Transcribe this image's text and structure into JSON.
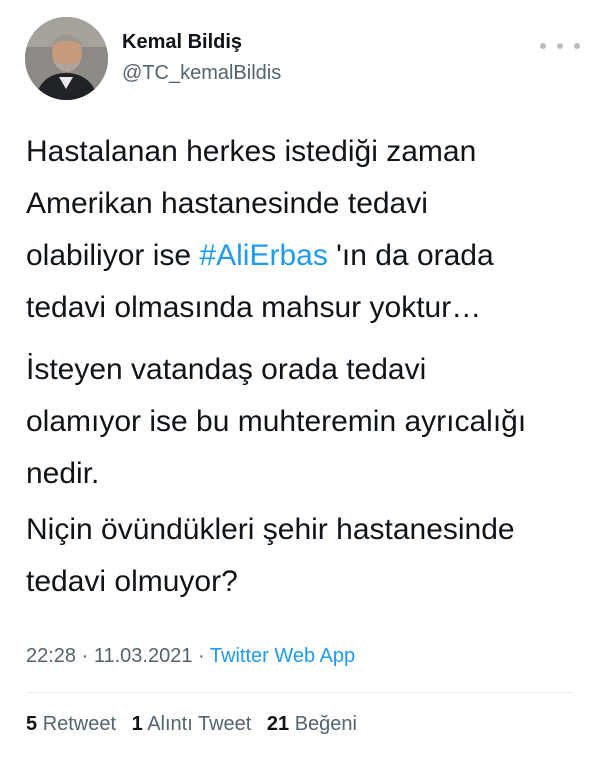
{
  "author": {
    "name": "Kemal Bildiş",
    "handle": "@TC_kemalBildis"
  },
  "tweet": {
    "p1": {
      "line1": "Hastalanan herkes istediği zaman",
      "line2": "Amerikan hastanesinde tedavi",
      "line3_before": "olabiliyor ise ",
      "hashtag": "#AliErbas",
      "line3_after": " 'ın da orada",
      "line4": "tedavi olmasında mahsur yoktur…"
    },
    "p2": {
      "line1": "İsteyen vatandaş orada tedavi",
      "line2": "olamıyor ise bu muhteremin ayrıcalığı",
      "line3": "nedir."
    },
    "p3": {
      "line1": "Niçin övündükleri şehir hastanesinde",
      "line2": "tedavi olmuyor?"
    }
  },
  "meta": {
    "time": "22:28",
    "sep1": " · ",
    "date": "11.03.2021",
    "sep2": " · ",
    "app": "Twitter Web App"
  },
  "stats": {
    "retweets": {
      "count": "5",
      "label": "Retweet"
    },
    "quotes": {
      "count": "1",
      "label": "Alıntı Tweet"
    },
    "likes": {
      "count": "21",
      "label": "Beğeni"
    }
  },
  "icons": {
    "more": "more-horizontal-icon"
  },
  "colors": {
    "accent": "#1d9bf0",
    "secondary_text": "#536471",
    "primary_text": "#0f1419"
  }
}
